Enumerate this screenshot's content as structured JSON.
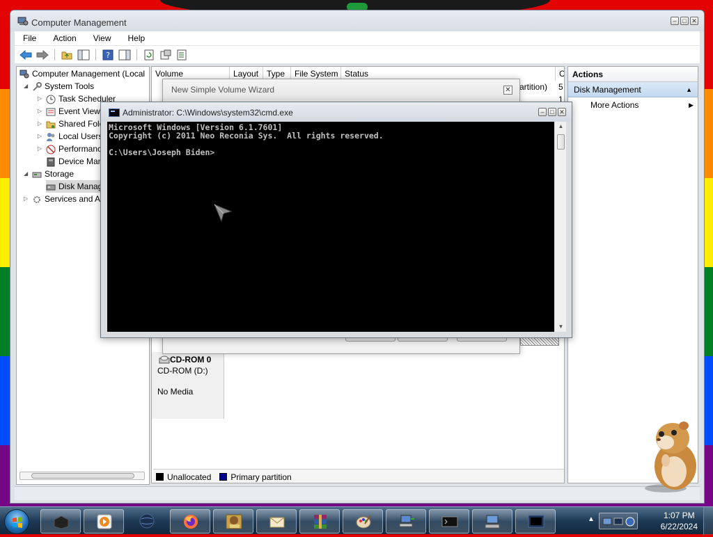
{
  "computer_management": {
    "title": "Computer Management",
    "menu": [
      "File",
      "Action",
      "View",
      "Help"
    ],
    "tree": {
      "root": "Computer Management (Local",
      "system_tools": "System Tools",
      "task_scheduler": "Task Scheduler",
      "event_viewer": "Event View",
      "shared_folders": "Shared Fold",
      "local_users": "Local Users",
      "performance": "Performanc",
      "device_manager": "Device Man",
      "storage": "Storage",
      "disk_management": "Disk Manag",
      "services": "Services and A"
    },
    "columns": [
      "Volume",
      "Layout",
      "Type",
      "File System",
      "Status",
      "C"
    ],
    "row_fragment": "artition)",
    "row_capacity_1": "5",
    "row_capacity_2": "1",
    "disk": {
      "name": "CD-ROM 0",
      "type": "CD-ROM (D:)",
      "media": "No Media"
    },
    "legend": [
      {
        "label": "Unallocated",
        "color": "#000000"
      },
      {
        "label": "Primary partition",
        "color": "#00008b"
      }
    ],
    "actions": {
      "header": "Actions",
      "section": "Disk Management",
      "more": "More Actions"
    }
  },
  "wizard": {
    "title": "New Simple Volume Wizard",
    "close": "✕"
  },
  "cmd": {
    "title": "Administrator: C:\\Windows\\system32\\cmd.exe",
    "line1": "Microsoft Windows [Version 6.1.7601]",
    "line2": "Copyright (c) 2011 Neo Reconia Sys.  All rights reserved.",
    "line3": "",
    "prompt": "C:\\Users\\Joseph Biden>"
  },
  "taskbar": {
    "time": "1:07 PM",
    "date": "6/22/2024"
  },
  "colors": {
    "accent": "#c3d8ef",
    "cmd_bg": "#000000",
    "cmd_text": "#c0c0c0"
  }
}
